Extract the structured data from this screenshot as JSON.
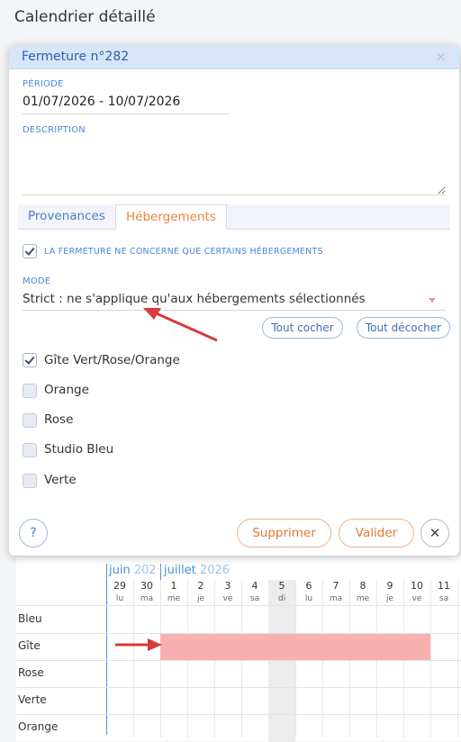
{
  "page": {
    "title": "Calendrier détaillé"
  },
  "dialog": {
    "title": "Fermeture n°282",
    "close_icon": "×",
    "period_label": "PÉRIODE",
    "period_value": "01/07/2026 - 10/07/2026",
    "description_label": "DESCRIPTION",
    "description_value": "",
    "tabs": [
      {
        "label": "Provenances",
        "active": false
      },
      {
        "label": "Hébergements",
        "active": true
      }
    ],
    "partial_checkbox_label": "LA FERMETURE NE CONCERNE QUE CERTAINS HÉBERGEMENTS",
    "partial_checked": true,
    "mode_label": "MODE",
    "mode_value": "Strict : ne s'applique qu'aux hébergements sélectionnés",
    "check_all": "Tout cocher",
    "uncheck_all": "Tout décocher",
    "accommodations": [
      {
        "label": "Gîte Vert/Rose/Orange",
        "checked": true
      },
      {
        "label": "Orange",
        "checked": false
      },
      {
        "label": "Rose",
        "checked": false
      },
      {
        "label": "Studio Bleu",
        "checked": false
      },
      {
        "label": "Verte",
        "checked": false
      }
    ],
    "help_label": "?",
    "delete_label": "Supprimer",
    "validate_label": "Valider",
    "cancel_icon": "✕"
  },
  "calendar": {
    "month1": "juin",
    "month1_year": "202",
    "month2": "juillet",
    "month2_year": "2026",
    "days": [
      {
        "num": "29",
        "name": "lu"
      },
      {
        "num": "30",
        "name": "ma"
      },
      {
        "num": "1",
        "name": "me"
      },
      {
        "num": "2",
        "name": "je"
      },
      {
        "num": "3",
        "name": "ve"
      },
      {
        "num": "4",
        "name": "sa"
      },
      {
        "num": "5",
        "name": "di"
      },
      {
        "num": "6",
        "name": "lu"
      },
      {
        "num": "7",
        "name": "ma"
      },
      {
        "num": "8",
        "name": "me"
      },
      {
        "num": "9",
        "name": "je"
      },
      {
        "num": "10",
        "name": "ve"
      },
      {
        "num": "11",
        "name": "sa"
      }
    ],
    "resources": [
      "Bleu",
      "Gîte",
      "Rose",
      "Verte",
      "Orange"
    ],
    "closure_color": "#f7b0b0",
    "arrow_color": "#d93a3a"
  }
}
